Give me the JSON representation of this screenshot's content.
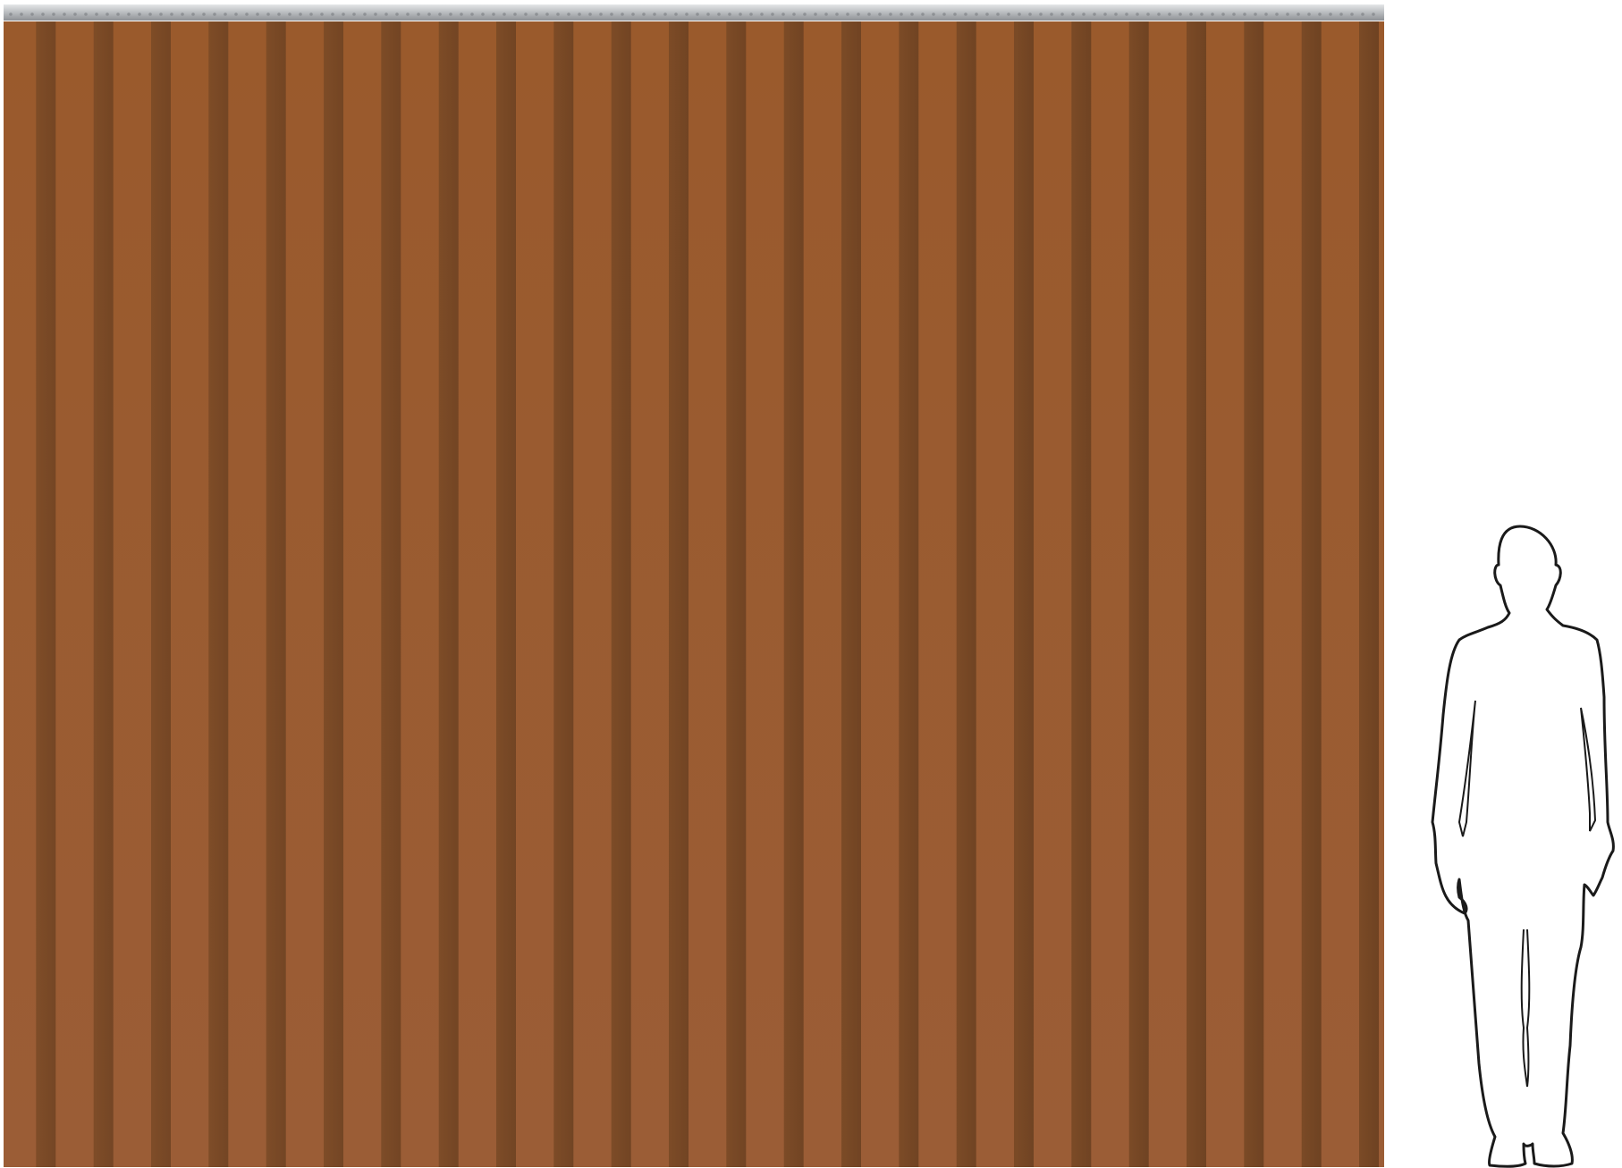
{
  "scene": {
    "subject": "strip-curtain",
    "background_color": "#ffffff"
  },
  "curtain": {
    "strip_count": 24,
    "colors": {
      "strip_light": "#9a5a2c",
      "strip_light_bottom": "#9b5d36",
      "overlap_dark": "#7a4a26",
      "overlap_dark_right": "#6e4222"
    },
    "rail": {
      "color": "#b9bcbf",
      "highlight": "#e4e6e8",
      "shadow": "#8e9195"
    }
  },
  "figure": {
    "type": "human-silhouette-scale-reference",
    "fill": "#ffffff",
    "stroke": "#1a1a1a"
  }
}
